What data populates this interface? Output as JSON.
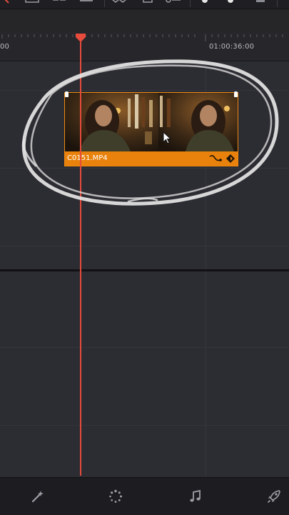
{
  "timeline": {
    "timecode_left": "00",
    "timecode_right": "01:00:36:00"
  },
  "clip": {
    "name": "C0151.MP4"
  },
  "colors": {
    "clip_accent": "#e8820c",
    "playhead": "#e64b3c",
    "annotation": "#e6e6e6",
    "background": "#2c2c33"
  },
  "bottom_nav": {
    "items": [
      "magic-wand-icon",
      "loading-dots-icon",
      "music-note-icon",
      "rocket-icon"
    ]
  }
}
